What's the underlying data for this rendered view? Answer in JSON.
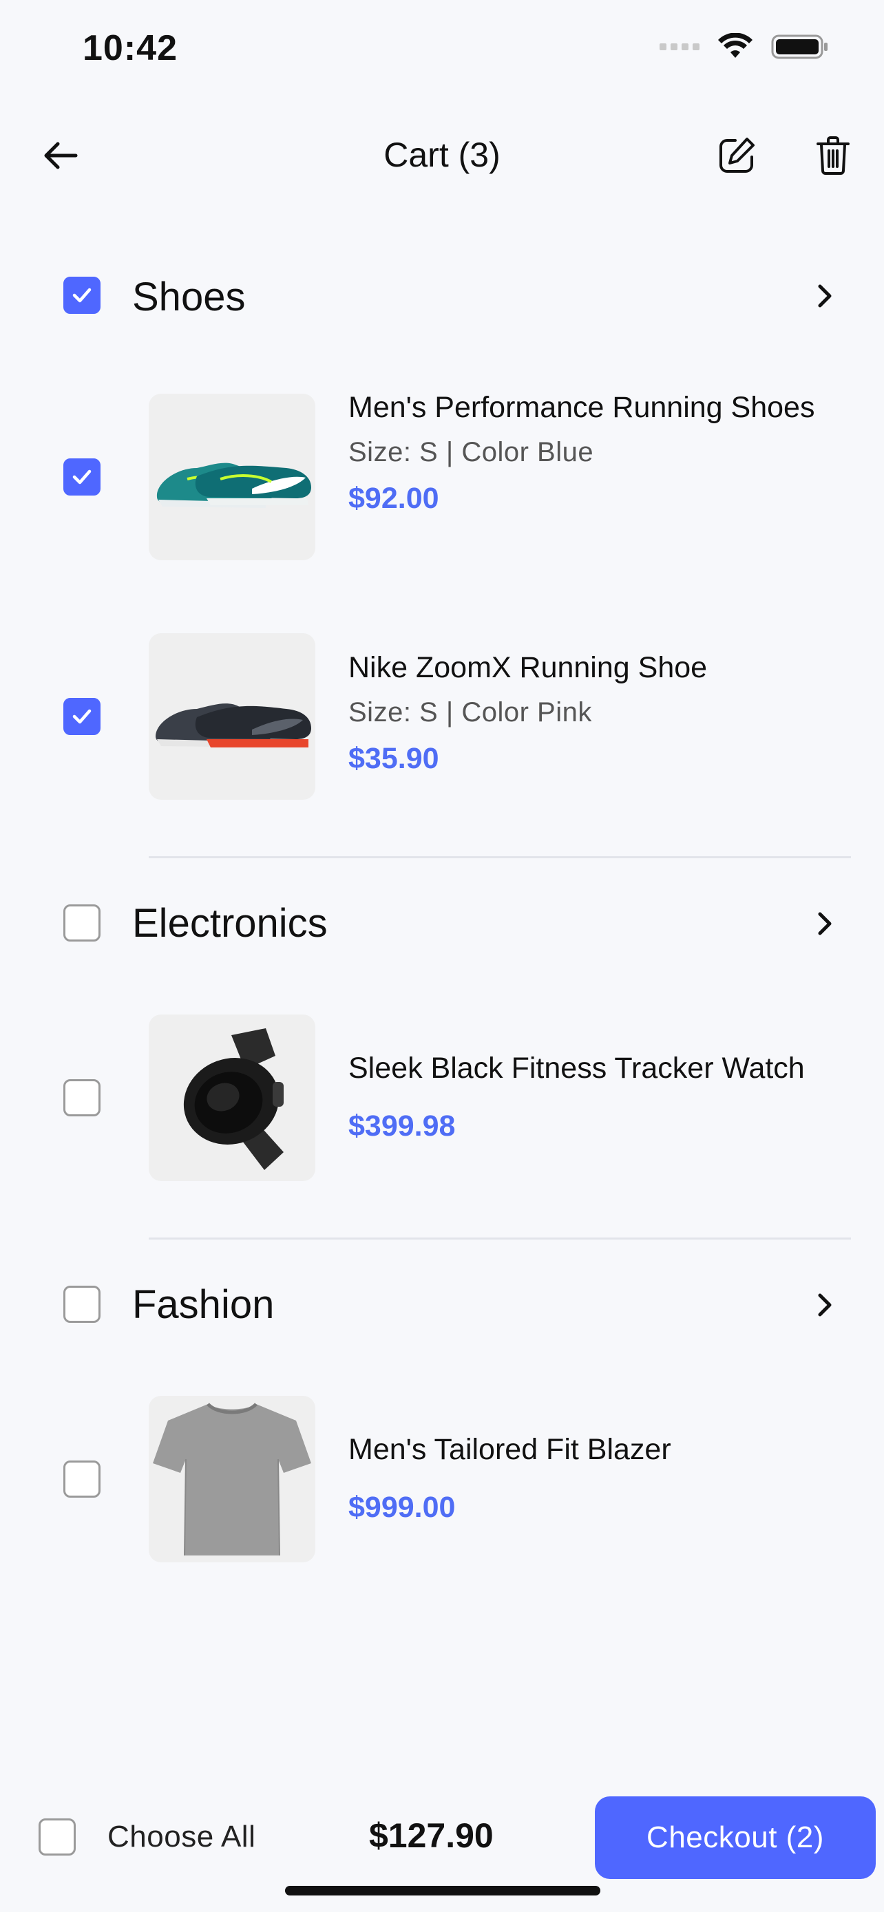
{
  "status": {
    "time": "10:42"
  },
  "header": {
    "title": "Cart (3)"
  },
  "categories": [
    {
      "name": "Shoes",
      "checked": true,
      "items": [
        {
          "name": "Men's Performance Running Shoes",
          "variant": "Size: S | Color Blue",
          "price": "$92.00",
          "checked": true,
          "image": "teal-running-shoes"
        },
        {
          "name": "Nike ZoomX Running Shoe",
          "variant": "Size: S | Color Pink",
          "price": "$35.90",
          "checked": true,
          "image": "dark-running-shoes"
        }
      ]
    },
    {
      "name": "Electronics",
      "checked": false,
      "items": [
        {
          "name": "Sleek Black Fitness Tracker Watch",
          "variant": "",
          "price": "$399.98",
          "checked": false,
          "image": "black-smartwatch"
        }
      ]
    },
    {
      "name": "Fashion",
      "checked": false,
      "items": [
        {
          "name": "Men's Tailored Fit Blazer",
          "variant": "",
          "price": "$999.00",
          "checked": false,
          "image": "gray-tshirt"
        }
      ]
    }
  ],
  "footer": {
    "choose_all_label": "Choose All",
    "choose_all_checked": false,
    "total": "$127.90",
    "checkout_label": "Checkout (2)"
  },
  "colors": {
    "accent": "#4f67ff",
    "price": "#4f6df5",
    "background": "#f7f8fb"
  },
  "icons": {
    "back": "arrow-left-icon",
    "edit": "edit-icon",
    "delete": "trash-icon",
    "chevron": "chevron-right-icon",
    "check": "check-icon"
  }
}
